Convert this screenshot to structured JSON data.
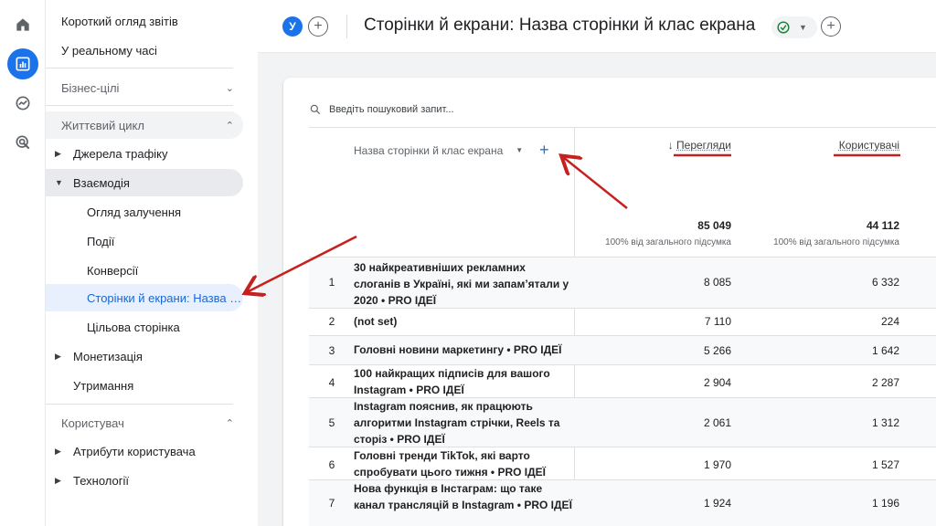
{
  "header": {
    "account_initial": "У",
    "title": "Сторінки й екрани: Назва сторінки й клас екрана"
  },
  "nav": {
    "top_items": [
      "Короткий огляд звітів",
      "У реальному часі"
    ],
    "business_goals": "Бізнес-цілі",
    "lifecycle": "Життєвий цикл",
    "traffic_sources": "Джерела трафіку",
    "engagement": "Взаємодія",
    "engagement_items": [
      "Огляд залучення",
      "Події",
      "Конверсії",
      "Сторінки й екрани: Назва сторінки й клас екрана",
      "Цільова сторінка"
    ],
    "monetization": "Монетизація",
    "retention": "Утримання",
    "user": "Користувач",
    "user_attributes": "Атрибути користувача",
    "technologies": "Технології"
  },
  "table": {
    "search_placeholder": "Введіть пошуковий запит...",
    "dimension_header": "Назва сторінки й клас екрана",
    "metric_headers": [
      "Перегляди",
      "Користувачі"
    ],
    "totals": [
      "85 049",
      "44 112"
    ],
    "totals_pct": [
      "100% від загального підсумка",
      "100% від загального підсумка"
    ],
    "rows": [
      {
        "num": "1",
        "name": "30 найкреативніших рекламних слоганів в Україні, які ми запам’ятали у 2020 • PRO ІДЕЇ",
        "views": "8 085",
        "users": "6 332"
      },
      {
        "num": "2",
        "name": "(not set)",
        "views": "7 110",
        "users": "224"
      },
      {
        "num": "3",
        "name": "Головні новини маркетингу • PRO ІДЕЇ",
        "views": "5 266",
        "users": "1 642"
      },
      {
        "num": "4",
        "name": "100 найкращих підписів для вашого Instagram • PRO ІДЕЇ",
        "views": "2 904",
        "users": "2 287"
      },
      {
        "num": "5",
        "name": "Instagram пояснив, як працюють алгоритми Instagram стрічки, Reels та сторіз • PRO ІДЕЇ",
        "views": "2 061",
        "users": "1 312"
      },
      {
        "num": "6",
        "name": "Головні тренди TikTok, які варто спробувати цього тижня • PRO ІДЕЇ",
        "views": "1 970",
        "users": "1 527"
      },
      {
        "num": "7",
        "name": "Нова функція в Інстаграм: що таке канал трансляцій в Instagram • PRO ІДЕЇ",
        "views": "1 924",
        "users": "1 196"
      }
    ]
  },
  "colors": {
    "accent": "#1a73e8",
    "annotation_red": "#c5221f",
    "active_nav_bg": "#e8f0fe"
  }
}
